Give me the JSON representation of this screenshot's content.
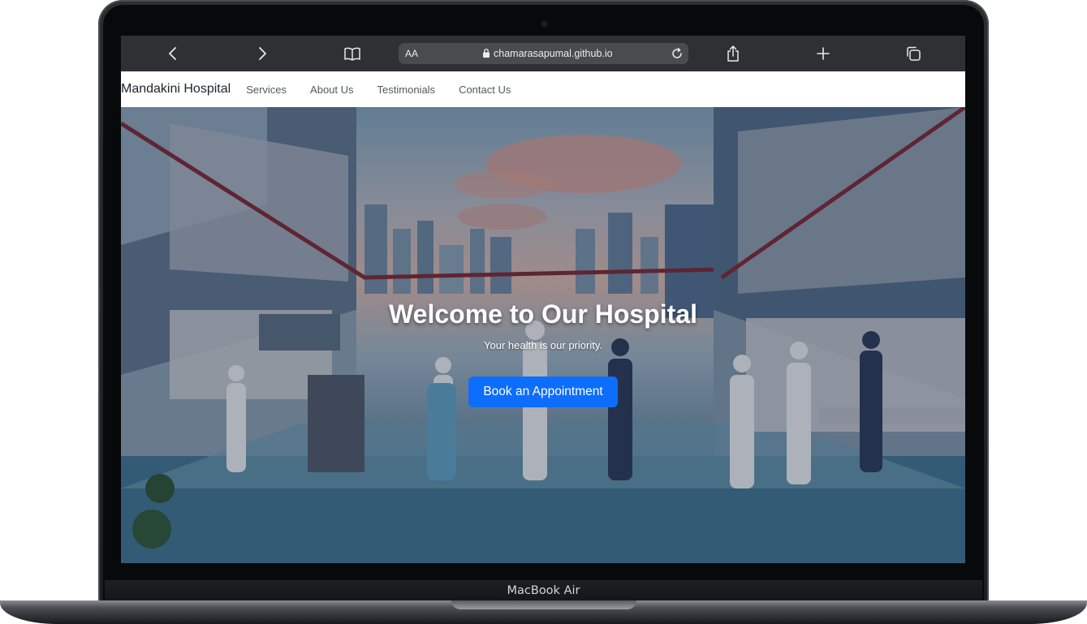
{
  "device": {
    "label": "MacBook Air"
  },
  "browser": {
    "reader_label": "AA",
    "url": "chamarasapumal.github.io",
    "icons": [
      "chevron-left-icon",
      "chevron-right-icon",
      "book-icon",
      "lock-icon",
      "reload-icon",
      "share-icon",
      "plus-icon",
      "tabs-icon"
    ]
  },
  "navbar": {
    "brand": "Mandakini Hospital",
    "links": [
      "Services",
      "About Us",
      "Testimonials",
      "Contact Us"
    ]
  },
  "hero": {
    "title": "Welcome to Our Hospital",
    "subtitle": "Your health is our priority.",
    "cta_label": "Book an Appointment"
  },
  "colors": {
    "primary_button": "#0d6efd",
    "toolbar": "#2f3033",
    "navbar": "#ffffff"
  }
}
